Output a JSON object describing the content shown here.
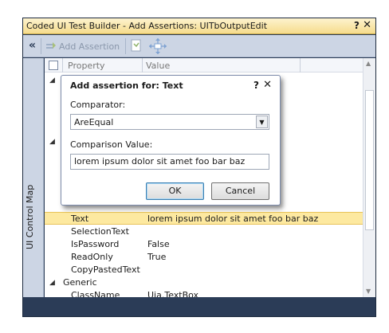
{
  "window": {
    "title": "Coded UI Test Builder - Add Assertions: UITbOutputEdit",
    "help_label": "?",
    "close_label": "✕"
  },
  "toolbar": {
    "collapse_label": "«",
    "add_assertion_label": "Add Assertion"
  },
  "sidebar": {
    "label": "UI Control Map"
  },
  "grid": {
    "columns": [
      "Property",
      "Value"
    ],
    "rows": [
      {
        "property": "Text",
        "value": "lorem ipsum dolor sit amet foo bar baz"
      },
      {
        "property": "SelectionText",
        "value": ""
      },
      {
        "property": "IsPassword",
        "value": "False"
      },
      {
        "property": "ReadOnly",
        "value": "True"
      },
      {
        "property": "CopyPastedText",
        "value": ""
      },
      {
        "property": "Generic",
        "value": ""
      },
      {
        "property": "ClassName",
        "value": "Uia.TextBox"
      }
    ]
  },
  "dialog": {
    "title": "Add assertion for: Text",
    "help_label": "?",
    "close_label": "✕",
    "comparator_label": "Comparator:",
    "comparator_value": "AreEqual",
    "comparison_label": "Comparison Value:",
    "comparison_value": "lorem ipsum dolor sit amet foo bar baz",
    "ok_label": "OK",
    "cancel_label": "Cancel"
  },
  "colors": {
    "title_bar": "#f6dc8c",
    "frame": "#2b3c57",
    "toolbar": "#ccd5e4",
    "selected_row": "#fde9a0"
  }
}
